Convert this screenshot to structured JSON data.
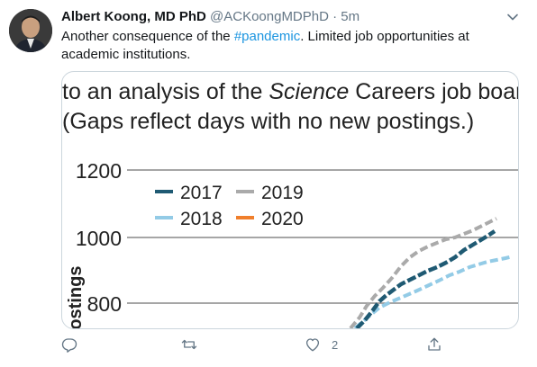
{
  "tweet": {
    "author": "Albert Koong, MD PhD",
    "handle": "@ACKoongMDPhD",
    "separator": "·",
    "time": "5m",
    "text_before": "Another consequence of the ",
    "hashtag": "#pandemic",
    "text_after": ". Limited job opportunities at academic institutions."
  },
  "media": {
    "caption_line1_before": "to an analysis of the ",
    "caption_line1_italic": "Science",
    "caption_line1_after": " Careers job board.",
    "caption_line2": "(Gaps reflect days with no new postings.)",
    "chart_data": {
      "type": "line",
      "ylabel": "Postings",
      "y_ticks": [
        800,
        1000,
        1200
      ],
      "ylim": [
        740,
        1240
      ],
      "grid": true,
      "legend": "top-left",
      "series": [
        {
          "name": "2017",
          "color": "#1f5a73"
        },
        {
          "name": "2019",
          "color": "#aaaaaa"
        },
        {
          "name": "2018",
          "color": "#93cbe6"
        },
        {
          "name": "2020",
          "color": "#f07f2c"
        }
      ]
    }
  },
  "actions": {
    "reply_count": "",
    "retweet_count": "",
    "like_count": "2",
    "share_count": ""
  },
  "colors": {
    "accent": "#1b95e0",
    "muted": "#657786"
  }
}
